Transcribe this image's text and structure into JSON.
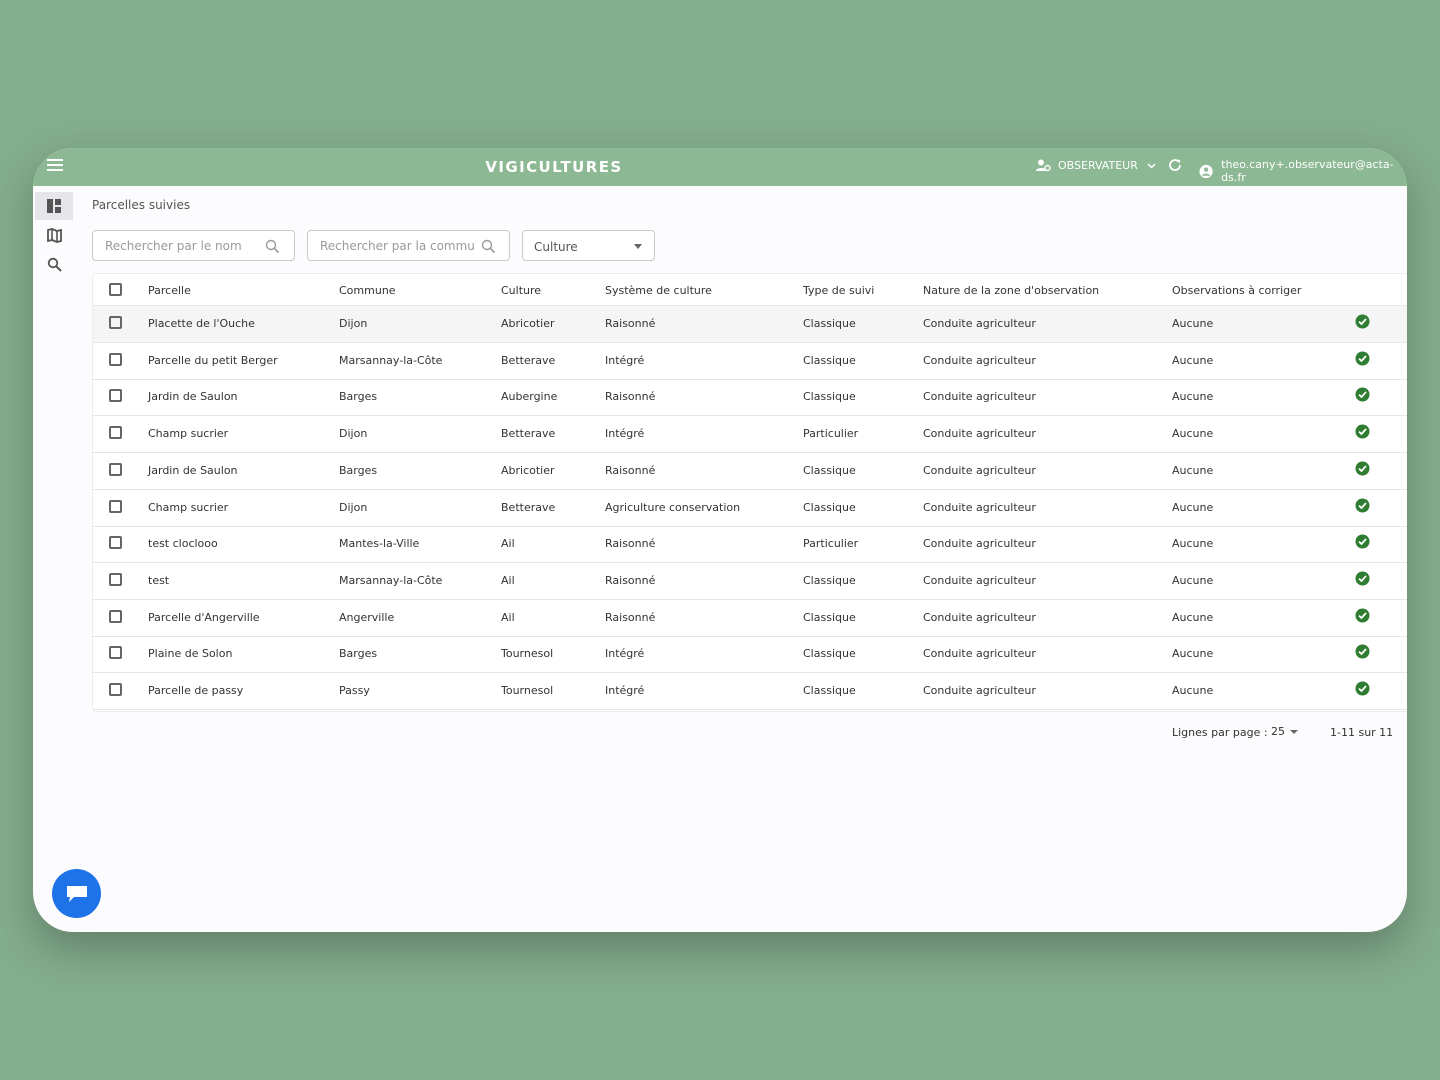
{
  "app": {
    "title": "VIGICULTURES"
  },
  "header": {
    "role_label": "OBSERVATEUR",
    "user_email": "theo.cany+.observateur@acta-ds.fr"
  },
  "sidebar": {
    "items": [
      {
        "icon": "dashboard-icon"
      },
      {
        "icon": "map-icon"
      },
      {
        "icon": "search-icon"
      }
    ]
  },
  "breadcrumb": "Parcelles suivies",
  "filters": {
    "name_placeholder": "Rechercher par le nom",
    "commune_placeholder": "Rechercher par la commune",
    "culture_label": "Culture"
  },
  "table": {
    "columns": [
      "Parcelle",
      "Commune",
      "Culture",
      "Système de culture",
      "Type de suivi",
      "Nature de la zone d'observation",
      "Observations à corriger"
    ],
    "rows": [
      [
        "Placette de l'Ouche",
        "Dijon",
        "Abricotier",
        "Raisonné",
        "Classique",
        "Conduite agriculteur",
        "Aucune"
      ],
      [
        "Parcelle du petit Berger",
        "Marsannay-la-Côte",
        "Betterave",
        "Intégré",
        "Classique",
        "Conduite agriculteur",
        "Aucune"
      ],
      [
        "Jardin de Saulon",
        "Barges",
        "Aubergine",
        "Raisonné",
        "Classique",
        "Conduite agriculteur",
        "Aucune"
      ],
      [
        "Champ sucrier",
        "Dijon",
        "Betterave",
        "Intégré",
        "Particulier",
        "Conduite agriculteur",
        "Aucune"
      ],
      [
        "Jardin de Saulon",
        "Barges",
        "Abricotier",
        "Raisonné",
        "Classique",
        "Conduite agriculteur",
        "Aucune"
      ],
      [
        "Champ sucrier",
        "Dijon",
        "Betterave",
        "Agriculture conservation",
        "Classique",
        "Conduite agriculteur",
        "Aucune"
      ],
      [
        "test cloclooo",
        "Mantes-la-Ville",
        "Ail",
        "Raisonné",
        "Particulier",
        "Conduite agriculteur",
        "Aucune"
      ],
      [
        "test",
        "Marsannay-la-Côte",
        "Ail",
        "Raisonné",
        "Classique",
        "Conduite agriculteur",
        "Aucune"
      ],
      [
        "Parcelle d'Angerville",
        "Angerville",
        "Ail",
        "Raisonné",
        "Classique",
        "Conduite agriculteur",
        "Aucune"
      ],
      [
        "Plaine de Solon",
        "Barges",
        "Tournesol",
        "Intégré",
        "Classique",
        "Conduite agriculteur",
        "Aucune"
      ],
      [
        "Parcelle de passy",
        "Passy",
        "Tournesol",
        "Intégré",
        "Classique",
        "Conduite agriculteur",
        "Aucune"
      ]
    ]
  },
  "pagination": {
    "rows_per_page_label": "Lignes par page :",
    "rows_per_page": "25",
    "range": "1-11 sur 11"
  },
  "colors": {
    "appbar": "#8db894",
    "background": "#84ad8c",
    "status_ok": "#2e7d32",
    "chat_button": "#1e73e8"
  }
}
